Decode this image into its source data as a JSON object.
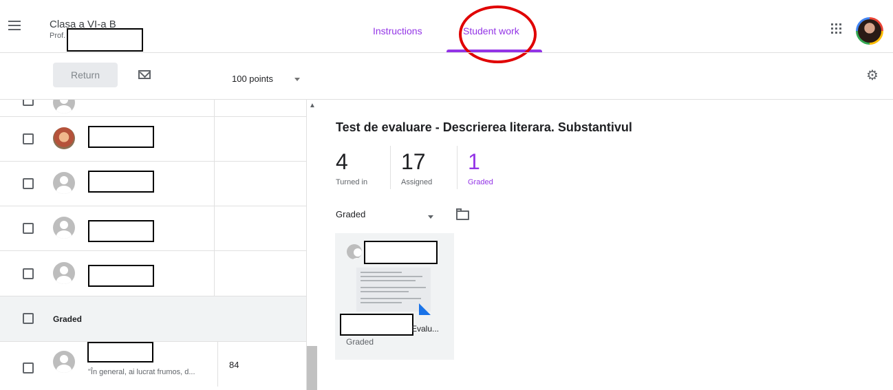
{
  "header": {
    "class_title": "Clasa a VI-a B",
    "teacher_prefix": "Prof.",
    "tabs": [
      {
        "label": "Instructions",
        "active": false
      },
      {
        "label": "Student work",
        "active": true
      }
    ],
    "accent_color": "#9334e6",
    "icons": [
      "menu-icon",
      "apps-icon",
      "account-avatar"
    ]
  },
  "toolbar": {
    "return_label": "Return",
    "points_value": "100 points",
    "icons": [
      "mail-icon",
      "settings-icon"
    ]
  },
  "students": {
    "rows": [
      {
        "status": "",
        "grade": "",
        "comment": ""
      },
      {
        "status": "",
        "grade": "",
        "comment": ""
      },
      {
        "status": "",
        "grade": "",
        "comment": ""
      },
      {
        "status": "",
        "grade": "",
        "comment": ""
      },
      {
        "status": "",
        "grade": "",
        "comment": ""
      }
    ],
    "group_label": "Graded",
    "graded_rows": [
      {
        "comment": "\"În general, ai lucrat frumos, d...",
        "grade": "84"
      }
    ]
  },
  "assignment": {
    "title": "Test de evaluare - Descrierea literara. Substantivul",
    "stats": [
      {
        "value": "4",
        "label": "Turned in"
      },
      {
        "value": "17",
        "label": "Assigned"
      },
      {
        "value": "1",
        "label": "Graded"
      }
    ],
    "filter": "Graded",
    "card": {
      "file_name_tail": "Evalu...",
      "status": "Graded"
    }
  }
}
